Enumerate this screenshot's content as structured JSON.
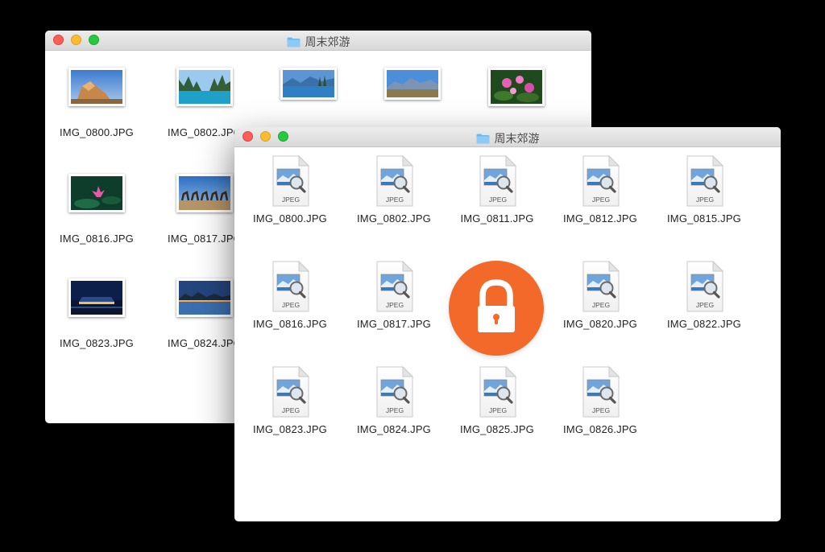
{
  "back_window": {
    "title": "周末郊游",
    "files": [
      {
        "name": "IMG_0800.JPG",
        "thumb": "sunset-rock"
      },
      {
        "name": "IMG_0802.JPG",
        "thumb": "lake-trees"
      },
      {
        "name": "",
        "thumb": "blue-lake"
      },
      {
        "name": "",
        "thumb": "mountain-plain"
      },
      {
        "name": "",
        "thumb": "pink-flowers"
      },
      {
        "name": "IMG_0816.JPG",
        "thumb": "lotus"
      },
      {
        "name": "IMG_0817.JPG",
        "thumb": "camels"
      },
      {
        "name": "IMG_0823.JPG",
        "thumb": "night-building"
      },
      {
        "name": "IMG_0824.JPG",
        "thumb": "dusk-lake"
      }
    ]
  },
  "front_window": {
    "title": "周末郊游",
    "file_icon_label": "JPEG",
    "files": [
      {
        "name": "IMG_0800.JPG"
      },
      {
        "name": "IMG_0802.JPG"
      },
      {
        "name": "IMG_0811.JPG"
      },
      {
        "name": "IMG_0812.JPG"
      },
      {
        "name": "IMG_0815.JPG"
      },
      {
        "name": "IMG_0816.JPG"
      },
      {
        "name": "IMG_0817.JPG"
      },
      {
        "name": "IMG_0820.JPG"
      },
      {
        "name": "IMG_0822.JPG"
      },
      {
        "name": "IMG_0823.JPG"
      },
      {
        "name": "IMG_0824.JPG"
      },
      {
        "name": "IMG_0825.JPG"
      },
      {
        "name": "IMG_0826.JPG"
      }
    ]
  },
  "lock_badge": {
    "icon": "padlock-icon",
    "color": "#f2692a"
  },
  "colors": {
    "folder": "#6ab8f0",
    "close": "#fc5f57",
    "minimize": "#fdbc2e",
    "zoom": "#28c840"
  }
}
